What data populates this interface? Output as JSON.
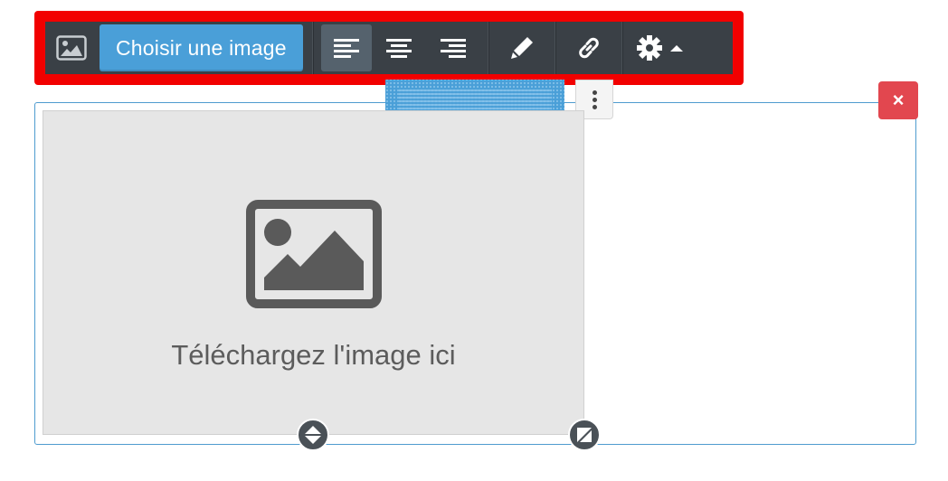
{
  "toolbar": {
    "image_icon": "image-icon",
    "choose_image_label": "Choisir une image",
    "align_left_icon": "align-left-icon",
    "align_center_icon": "align-center-icon",
    "align_right_icon": "align-right-icon",
    "edit_icon": "pencil-icon",
    "link_icon": "link-icon",
    "settings_icon": "gear-icon",
    "settings_caret_icon": "caret-up-icon",
    "active_alignment": "left"
  },
  "block": {
    "drag_handle_icon": "drag-handle",
    "more_icon": "vertical-dots-icon",
    "close_label": "×",
    "upload_placeholder_text": "Téléchargez l'image ici",
    "placeholder_icon": "image-placeholder-icon",
    "resize_vertical_icon": "vertical-resize-icon",
    "resize_corner_icon": "corner-resize-icon"
  },
  "colors": {
    "highlight": "#f20000",
    "toolbar_bg": "#3a4046",
    "accent_blue": "#4a9fd8",
    "close_red": "#e2474f",
    "dropzone_bg": "#e6e6e6"
  }
}
